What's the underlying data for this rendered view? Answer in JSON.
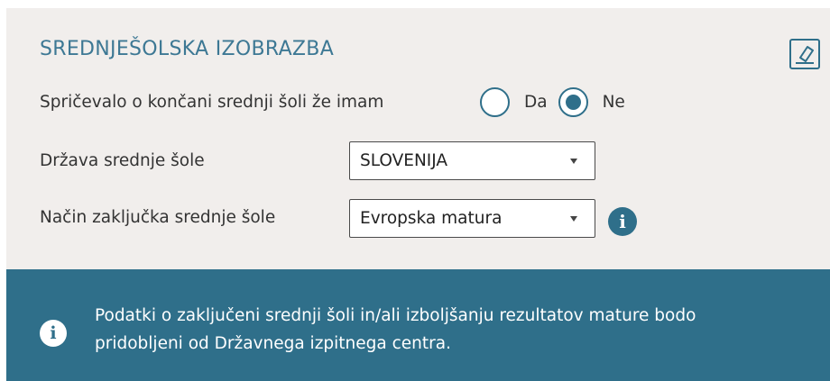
{
  "section": {
    "title": "SREDNJEŠOLSKA IZOBRAZBA",
    "clear_icon": "eraser-icon"
  },
  "certificate": {
    "label": "Spričevalo o končani srednji šoli že imam",
    "options": [
      {
        "label": "Da",
        "checked": false
      },
      {
        "label": "Ne",
        "checked": true
      }
    ]
  },
  "country": {
    "label": "Država srednje šole",
    "value": "SLOVENIJA"
  },
  "completion": {
    "label": "Način zaključka srednje šole",
    "value": "Evropska matura",
    "info_icon": "info-icon",
    "info_glyph": "i"
  },
  "notice": {
    "icon": "info-icon",
    "icon_glyph": "i",
    "text": "Podatki o zaključeni srednji šoli in/ali izboljšanju rezultatov mature bodo pridobljeni od Državnega izpitnega centra."
  },
  "colors": {
    "accent": "#2f6f8a",
    "title": "#3d7894",
    "panel_bg": "#f1eeec"
  }
}
